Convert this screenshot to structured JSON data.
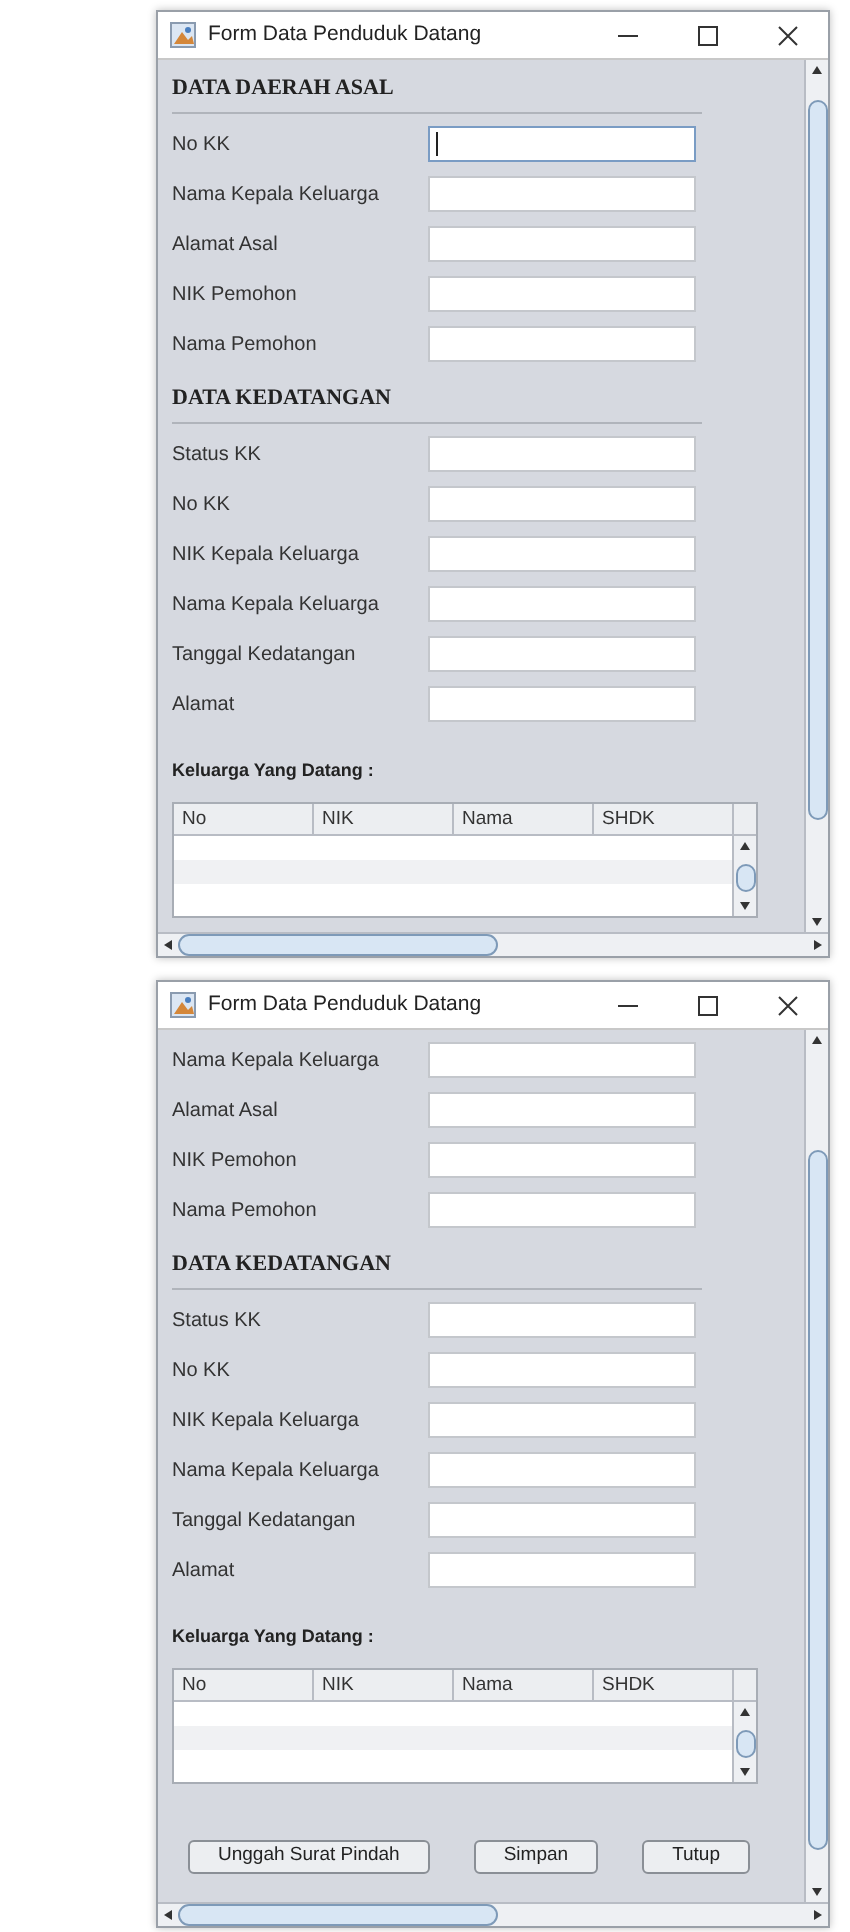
{
  "windows": [
    {
      "title": "Form Data Penduduk Datang",
      "sections": [
        {
          "heading": "DATA DAERAH ASAL",
          "fields": [
            {
              "label": "No KK",
              "focused": true
            },
            {
              "label": "Nama Kepala Keluarga",
              "focused": false
            },
            {
              "label": "Alamat Asal",
              "focused": false
            },
            {
              "label": "NIK Pemohon",
              "focused": false
            },
            {
              "label": "Nama Pemohon",
              "focused": false
            }
          ]
        },
        {
          "heading": "DATA KEDATANGAN",
          "fields": [
            {
              "label": "Status KK",
              "focused": false
            },
            {
              "label": "No KK",
              "focused": false
            },
            {
              "label": "NIK Kepala Keluarga",
              "focused": false
            },
            {
              "label": "Nama Kepala Keluarga",
              "focused": false
            },
            {
              "label": "Tanggal Kedatangan",
              "focused": false
            },
            {
              "label": "Alamat",
              "focused": false
            }
          ]
        }
      ],
      "table_title": "Keluarga Yang Datang :",
      "columns": [
        "No",
        "NIK",
        "Nama",
        "SHDK"
      ]
    },
    {
      "title": "Form Data Penduduk Datang",
      "sections": [
        {
          "fields": [
            {
              "label": "Nama Kepala Keluarga",
              "focused": false
            },
            {
              "label": "Alamat Asal",
              "focused": false
            },
            {
              "label": "NIK Pemohon",
              "focused": false
            },
            {
              "label": "Nama Pemohon",
              "focused": false
            }
          ]
        },
        {
          "heading": "DATA KEDATANGAN",
          "fields": [
            {
              "label": "Status KK",
              "focused": false
            },
            {
              "label": "No KK",
              "focused": false
            },
            {
              "label": "NIK Kepala Keluarga",
              "focused": false
            },
            {
              "label": "Nama Kepala Keluarga",
              "focused": false
            },
            {
              "label": "Tanggal Kedatangan",
              "focused": false
            },
            {
              "label": "Alamat",
              "focused": false
            }
          ]
        }
      ],
      "table_title": "Keluarga Yang Datang :",
      "columns": [
        "No",
        "NIK",
        "Nama",
        "SHDK"
      ],
      "buttons": [
        "Unggah Surat Pindah",
        "Simpan",
        "Tutup"
      ]
    }
  ]
}
